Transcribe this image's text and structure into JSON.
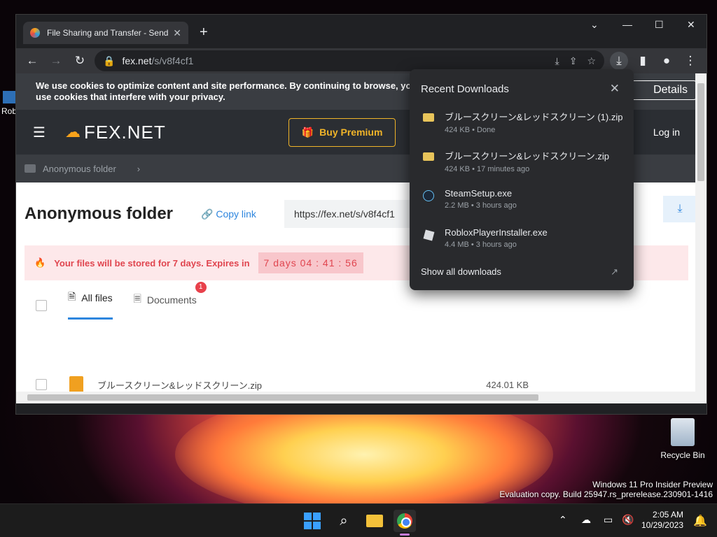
{
  "desktop": {
    "icon_left_label": "Rob",
    "recycle_bin_label": "Recycle Bin",
    "watermark_line1": "Windows 11 Pro Insider Preview",
    "watermark_line2": "Evaluation copy. Build 25947.rs_prerelease.230901-1416"
  },
  "browser": {
    "tab_title": "File Sharing and Transfer - Send",
    "url_host": "fex.net",
    "url_path": "/s/v8f4cf1"
  },
  "page": {
    "cookie_text": "We use cookies to optimize content and site performance. By continuing to browse, you agr",
    "cookie_text2": "use cookies that interfere with your privacy.",
    "cookie_button": "Details",
    "logo_text": "FEX.NET",
    "buy_premium": "Buy Premium",
    "login": "Log in",
    "breadcrumb": "Anonymous folder",
    "folder_title": "Anonymous folder",
    "copy_link": "Copy link",
    "share_url": "https://fex.net/s/v8f4cf1",
    "expire_text": "Your files will be stored for 7 days. Expires in",
    "expire_timer": "7 days  04 : 41 : 56",
    "tab_all": "All files",
    "tab_docs": "Documents",
    "docs_badge": "1",
    "file_name": "ブルースクリーン&レッドスクリーン.zip",
    "file_size": "424.01 KB"
  },
  "downloads": {
    "title": "Recent Downloads",
    "items": [
      {
        "name": "ブルースクリーン&レッドスクリーン (1).zip",
        "meta": "424 KB • Done",
        "icon": "zip-icon"
      },
      {
        "name": "ブルースクリーン&レッドスクリーン.zip",
        "meta": "424 KB • 17 minutes ago",
        "icon": "zip-icon"
      },
      {
        "name": "SteamSetup.exe",
        "meta": "2.2 MB • 3 hours ago",
        "icon": "steam-icon"
      },
      {
        "name": "RobloxPlayerInstaller.exe",
        "meta": "4.4 MB • 3 hours ago",
        "icon": "roblox-icon"
      }
    ],
    "show_all": "Show all downloads"
  },
  "taskbar": {
    "time": "2:05 AM",
    "date": "10/29/2023"
  },
  "colors": {
    "accent": "#2e86de",
    "premium": "#f0b429",
    "expire_red": "#e0454f"
  }
}
